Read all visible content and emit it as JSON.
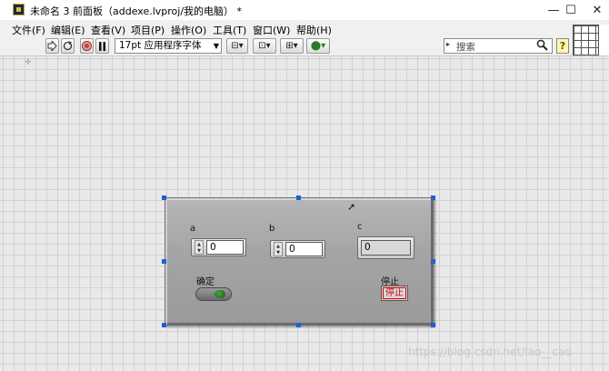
{
  "window": {
    "title": "未命名 3 前面板（addexe.lvproj/我的电脑） *",
    "minimize": "—",
    "maximize": "☐",
    "close": "✕"
  },
  "menu": [
    "文件(F)",
    "编辑(E)",
    "查看(V)",
    "项目(P)",
    "操作(O)",
    "工具(T)",
    "窗口(W)",
    "帮助(H)"
  ],
  "toolbar": {
    "run_icon": "run-arrow-icon",
    "run_continuous_icon": "run-continuously-icon",
    "abort_icon": "abort-icon",
    "pause_icon": "pause-icon",
    "font": "17pt 应用程序字体",
    "search_placeholder": "搜索",
    "help": "?"
  },
  "controls": {
    "a": {
      "label": "a",
      "value": "0"
    },
    "b": {
      "label": "b",
      "value": "0"
    },
    "c": {
      "label": "c",
      "value": "0"
    },
    "ok": {
      "label": "确定"
    },
    "stop": {
      "label": "停止",
      "button_text": "停止"
    }
  },
  "watermark": "https://blog.csdn.net/lao__cao"
}
